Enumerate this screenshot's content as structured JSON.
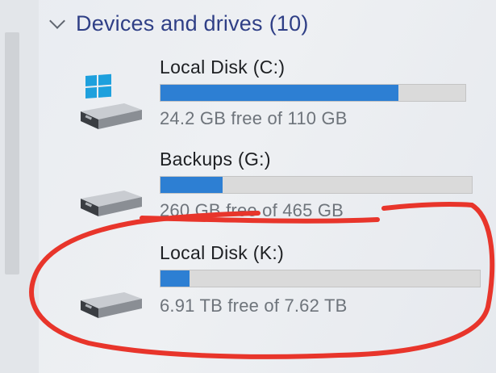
{
  "group": {
    "title": "Devices and drives",
    "count": "(10)"
  },
  "drives": [
    {
      "name": "Local Disk (C:)",
      "space_text": "24.2 GB free of 110 GB",
      "used_fraction": 0.78,
      "icon": "windows-system-drive-icon"
    },
    {
      "name": "Backups (G:)",
      "space_text": "260 GB free of 465 GB",
      "used_fraction": 0.2,
      "icon": "hard-drive-icon"
    },
    {
      "name": "Local Disk (K:)",
      "space_text": "6.91 TB free of 7.62 TB",
      "used_fraction": 0.09,
      "icon": "hard-drive-icon"
    }
  ],
  "colors": {
    "header_text": "#2f3f86",
    "bar_fill": "#2d7fd3",
    "bar_track": "#dadada",
    "windows_logo": "#1ea0dd",
    "annotation_red": "#e8352b"
  }
}
